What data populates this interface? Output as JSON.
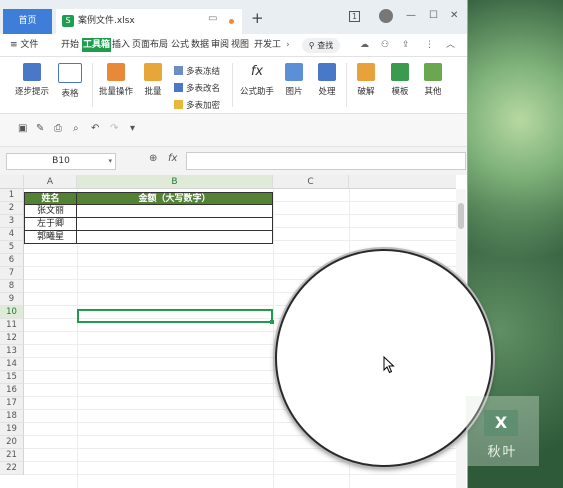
{
  "window": {
    "home_tab": "首页",
    "file_tab": "案例文件.xlsx",
    "new_tab": "+",
    "badge": "1",
    "controls": [
      "—",
      "☐",
      "✕"
    ]
  },
  "menu": {
    "file": "≡ 文件",
    "items": [
      "开始",
      "工具箱",
      "插入",
      "页面布局",
      "公式",
      "数据",
      "审阅",
      "视图",
      "开发工"
    ],
    "active_index": 1,
    "search": "查找"
  },
  "ribbon": {
    "step_tip": "逐步提示",
    "table": "表格",
    "batch_op": "批量操作",
    "batch": "批量",
    "small": [
      "多表冻结",
      "多表改名",
      "多表加密"
    ],
    "formula_helper": "公式助手",
    "image": "图片",
    "process": "处理",
    "crack": "破解",
    "template": "模板",
    "other": "其他"
  },
  "formula_bar": {
    "cell_ref": "B10",
    "fx": "fx",
    "zoom_icon": "⊕"
  },
  "sheet": {
    "columns": [
      "A",
      "B",
      "C"
    ],
    "rows": [
      "1",
      "2",
      "3",
      "4",
      "5",
      "6",
      "7",
      "8",
      "9",
      "10",
      "11",
      "12",
      "13",
      "14",
      "15",
      "16",
      "17",
      "18",
      "19",
      "20",
      "21",
      "22"
    ],
    "selected_row": "10",
    "header": [
      "姓名",
      "金额（大写数字）"
    ],
    "names": [
      "张文丽",
      "左于卿",
      "郭曦星"
    ]
  },
  "logo": {
    "mark": "X",
    "text": "秋叶"
  },
  "colors": {
    "accent": "#1f9c4e",
    "header_fill": "#548235",
    "home_tab": "#3e7ed8"
  }
}
